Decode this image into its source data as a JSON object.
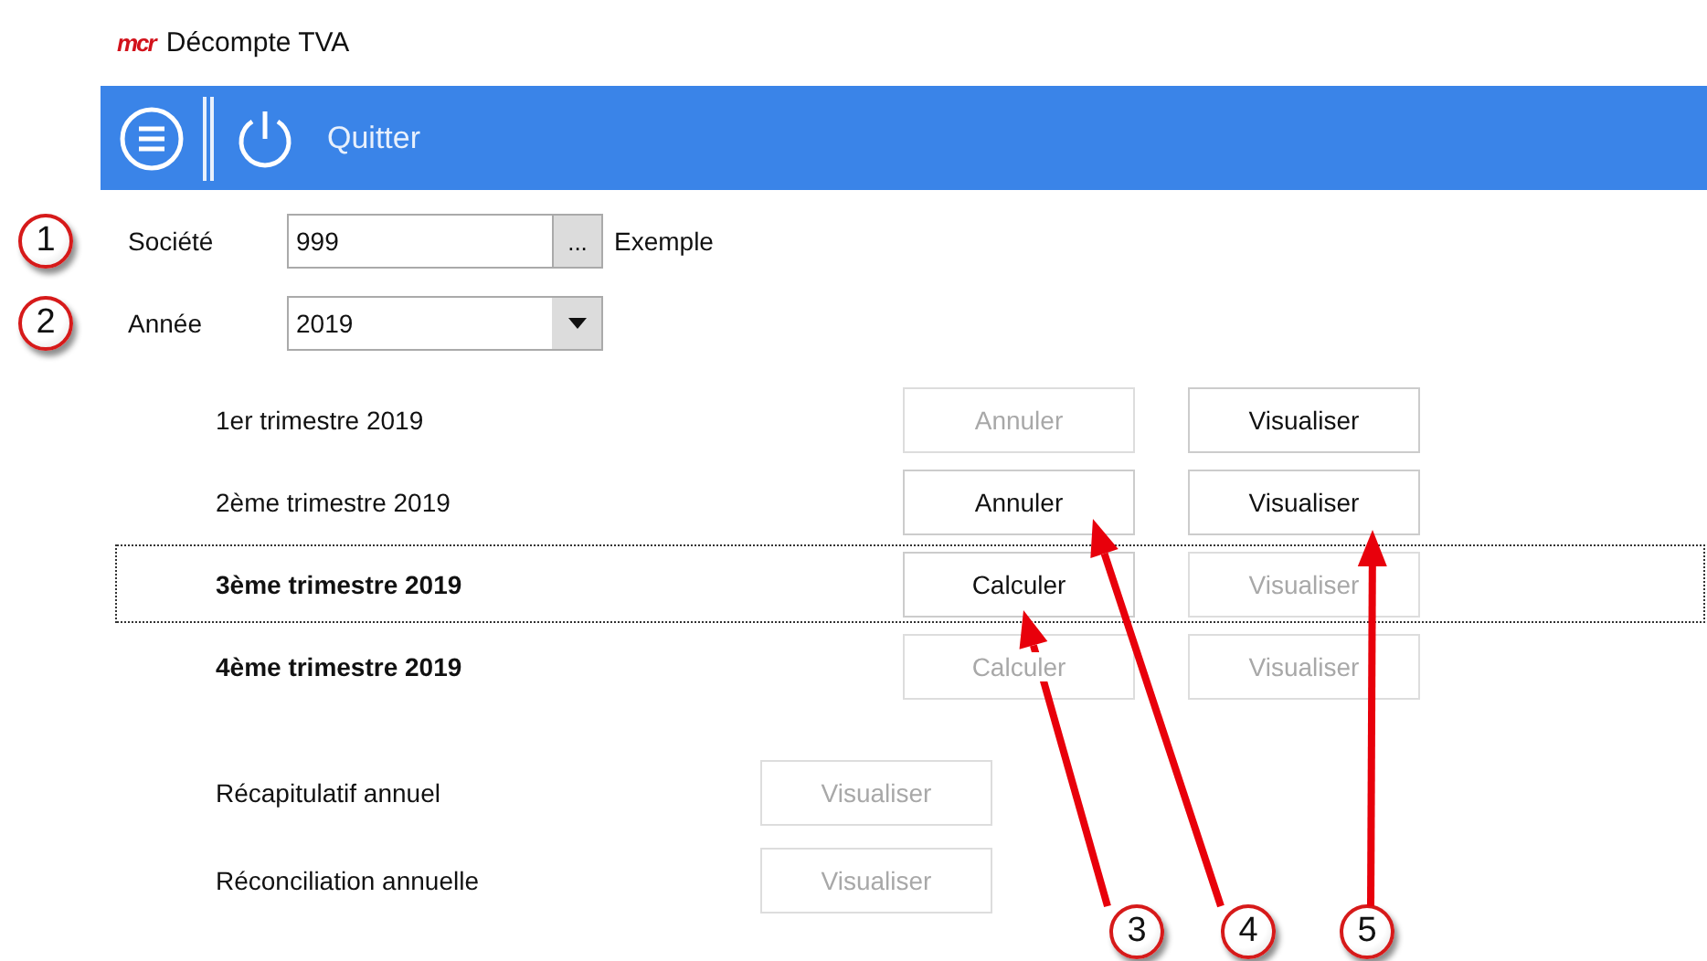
{
  "window": {
    "logo": "mcr",
    "title": "Décompte TVA"
  },
  "toolbar": {
    "quit_label": "Quitter"
  },
  "form": [
    {
      "callout": "1",
      "label": "Société",
      "kind": "lookup",
      "value": "999",
      "button": "...",
      "description": "Exemple"
    },
    {
      "callout": "2",
      "label": "Année",
      "kind": "dropdown",
      "value": "2019"
    }
  ],
  "quarters": [
    {
      "label": "1er trimestre 2019",
      "bold": false,
      "focused": false,
      "buttons": [
        {
          "label": "Annuler",
          "disabled": true
        },
        {
          "label": "Visualiser",
          "disabled": false
        }
      ]
    },
    {
      "label": "2ème trimestre 2019",
      "bold": false,
      "focused": false,
      "buttons": [
        {
          "label": "Annuler",
          "disabled": false
        },
        {
          "label": "Visualiser",
          "disabled": false
        }
      ]
    },
    {
      "label": "3ème trimestre 2019",
      "bold": true,
      "focused": true,
      "buttons": [
        {
          "label": "Calculer",
          "disabled": false
        },
        {
          "label": "Visualiser",
          "disabled": true
        }
      ]
    },
    {
      "label": "4ème trimestre 2019",
      "bold": true,
      "focused": false,
      "buttons": [
        {
          "label": "Calculer",
          "disabled": true
        },
        {
          "label": "Visualiser",
          "disabled": true
        }
      ]
    }
  ],
  "annual": [
    {
      "label": "Récapitulatif annuel",
      "button": {
        "label": "Visualiser",
        "disabled": true
      }
    },
    {
      "label": "Réconciliation annuelle",
      "button": {
        "label": "Visualiser",
        "disabled": true
      }
    }
  ],
  "annotations": [
    {
      "number": "3"
    },
    {
      "number": "4"
    },
    {
      "number": "5"
    }
  ]
}
